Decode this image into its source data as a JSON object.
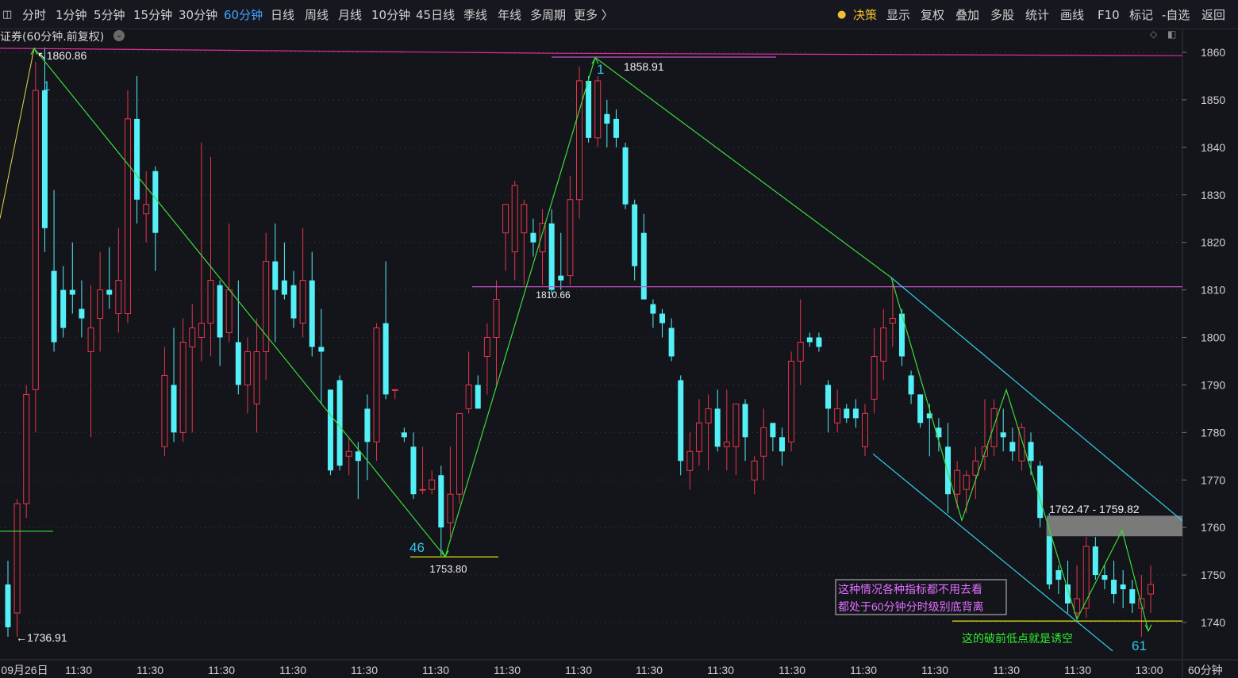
{
  "toolbar": {
    "periods": [
      "分时",
      "1分钟",
      "5分钟",
      "15分钟",
      "30分钟",
      "60分钟",
      "日线",
      "周线",
      "月线",
      "10分钟",
      "45日线",
      "季线",
      "年线",
      "多周期",
      "更多 〉"
    ],
    "active_period": "60分钟",
    "right": [
      "决策",
      "显示",
      "复权",
      "叠加",
      "多股",
      "统计",
      "画线",
      "F10",
      "标记",
      "-自选",
      "返回"
    ]
  },
  "chart_title": "证券(60分钟.前复权)",
  "period_label": "60分钟",
  "colors": {
    "up": "#e8364b",
    "down": "#54f0f7",
    "background": "#14141b",
    "grid": "#3a3a48",
    "zigzag": "#3bdc3b",
    "channel": "#30d5e6",
    "hline_magenta": "#c255c8",
    "hline_top": "#e0309a",
    "level_yellow": "#d4d414",
    "note_purple": "#e070ff",
    "note_green": "#2ef02e"
  },
  "chart_data": {
    "type": "candlestick",
    "ylim": [
      1731,
      1864
    ],
    "y_ticks": [
      1860,
      1850,
      1840,
      1830,
      1820,
      1810,
      1800,
      1790,
      1780,
      1770,
      1760,
      1750,
      1740
    ],
    "x_tick_labels": [
      "09月26日",
      "11:30",
      "11:30",
      "11:30",
      "11:30",
      "11:30",
      "11:30",
      "11:30",
      "11:30",
      "11:30",
      "11:30",
      "11:30",
      "11:30",
      "11:30",
      "11:30",
      "11:30",
      "13:00"
    ],
    "candles": [
      {
        "o": 1748,
        "h": 1753,
        "l": 1737,
        "c": 1739
      },
      {
        "o": 1742,
        "h": 1766,
        "l": 1737,
        "c": 1765
      },
      {
        "o": 1765,
        "h": 1790,
        "l": 1762,
        "c": 1788
      },
      {
        "o": 1789,
        "h": 1858,
        "l": 1780,
        "c": 1852
      },
      {
        "o": 1852,
        "h": 1861,
        "l": 1818,
        "c": 1823
      },
      {
        "o": 1814,
        "h": 1831,
        "l": 1797,
        "c": 1799
      },
      {
        "o": 1810,
        "h": 1815,
        "l": 1800,
        "c": 1802
      },
      {
        "o": 1810,
        "h": 1820,
        "l": 1805,
        "c": 1809
      },
      {
        "o": 1806,
        "h": 1812,
        "l": 1800,
        "c": 1804
      },
      {
        "o": 1797,
        "h": 1811,
        "l": 1779,
        "c": 1802
      },
      {
        "o": 1804,
        "h": 1818,
        "l": 1797,
        "c": 1810
      },
      {
        "o": 1810,
        "h": 1819,
        "l": 1806,
        "c": 1809
      },
      {
        "o": 1805,
        "h": 1823,
        "l": 1801,
        "c": 1812
      },
      {
        "o": 1805,
        "h": 1852,
        "l": 1803,
        "c": 1846
      },
      {
        "o": 1846,
        "h": 1855,
        "l": 1824,
        "c": 1829
      },
      {
        "o": 1826,
        "h": 1835,
        "l": 1820,
        "c": 1828
      },
      {
        "o": 1835,
        "h": 1836,
        "l": 1814,
        "c": 1822
      },
      {
        "o": 1777,
        "h": 1798,
        "l": 1775,
        "c": 1792
      },
      {
        "o": 1790,
        "h": 1802,
        "l": 1778,
        "c": 1780
      },
      {
        "o": 1780,
        "h": 1804,
        "l": 1778,
        "c": 1799
      },
      {
        "o": 1798,
        "h": 1807,
        "l": 1780,
        "c": 1802
      },
      {
        "o": 1800,
        "h": 1841,
        "l": 1795,
        "c": 1803
      },
      {
        "o": 1803,
        "h": 1838,
        "l": 1796,
        "c": 1812
      },
      {
        "o": 1811,
        "h": 1812,
        "l": 1794,
        "c": 1800
      },
      {
        "o": 1801,
        "h": 1824,
        "l": 1799,
        "c": 1810
      },
      {
        "o": 1799,
        "h": 1812,
        "l": 1788,
        "c": 1790
      },
      {
        "o": 1790,
        "h": 1800,
        "l": 1784,
        "c": 1797
      },
      {
        "o": 1786,
        "h": 1804,
        "l": 1780,
        "c": 1797
      },
      {
        "o": 1797,
        "h": 1822,
        "l": 1791,
        "c": 1816
      },
      {
        "o": 1816,
        "h": 1824,
        "l": 1799,
        "c": 1810
      },
      {
        "o": 1812,
        "h": 1820,
        "l": 1808,
        "c": 1809
      },
      {
        "o": 1811,
        "h": 1814,
        "l": 1802,
        "c": 1804
      },
      {
        "o": 1803,
        "h": 1823,
        "l": 1800,
        "c": 1812
      },
      {
        "o": 1812,
        "h": 1818,
        "l": 1796,
        "c": 1798
      },
      {
        "o": 1798,
        "h": 1806,
        "l": 1786,
        "c": 1797
      },
      {
        "o": 1789,
        "h": 1789,
        "l": 1771,
        "c": 1772
      },
      {
        "o": 1791,
        "h": 1792,
        "l": 1772,
        "c": 1773
      },
      {
        "o": 1775,
        "h": 1779,
        "l": 1771,
        "c": 1776
      },
      {
        "o": 1776,
        "h": 1778,
        "l": 1766,
        "c": 1774
      },
      {
        "o": 1785,
        "h": 1788,
        "l": 1770,
        "c": 1778
      },
      {
        "o": 1778,
        "h": 1803,
        "l": 1774,
        "c": 1802
      },
      {
        "o": 1803,
        "h": 1816,
        "l": 1787,
        "c": 1788
      },
      {
        "o": 1789,
        "h": 1789,
        "l": 1787,
        "c": 1789
      },
      {
        "o": 1780,
        "h": 1781,
        "l": 1778,
        "c": 1779
      },
      {
        "o": 1777,
        "h": 1780,
        "l": 1766,
        "c": 1767
      },
      {
        "o": 1768,
        "h": 1777,
        "l": 1767,
        "c": 1768
      },
      {
        "o": 1768,
        "h": 1772,
        "l": 1767,
        "c": 1770
      },
      {
        "o": 1771,
        "h": 1773,
        "l": 1754,
        "c": 1760
      },
      {
        "o": 1761,
        "h": 1777,
        "l": 1758,
        "c": 1767
      },
      {
        "o": 1767,
        "h": 1781,
        "l": 1765,
        "c": 1784
      },
      {
        "o": 1785,
        "h": 1797,
        "l": 1784,
        "c": 1790
      },
      {
        "o": 1790,
        "h": 1792,
        "l": 1786,
        "c": 1785
      },
      {
        "o": 1796,
        "h": 1803,
        "l": 1788,
        "c": 1800
      },
      {
        "o": 1800,
        "h": 1812,
        "l": 1790,
        "c": 1808
      },
      {
        "o": 1822,
        "h": 1824,
        "l": 1814,
        "c": 1828
      },
      {
        "o": 1818,
        "h": 1833,
        "l": 1812,
        "c": 1832
      },
      {
        "o": 1822,
        "h": 1829,
        "l": 1811,
        "c": 1828
      },
      {
        "o": 1822,
        "h": 1825,
        "l": 1817,
        "c": 1820
      },
      {
        "o": 1818,
        "h": 1827,
        "l": 1811,
        "c": 1824
      },
      {
        "o": 1824,
        "h": 1827,
        "l": 1809,
        "c": 1810
      },
      {
        "o": 1813,
        "h": 1822,
        "l": 1810,
        "c": 1812
      },
      {
        "o": 1813,
        "h": 1834,
        "l": 1811,
        "c": 1829
      },
      {
        "o": 1829,
        "h": 1857,
        "l": 1825,
        "c": 1854
      },
      {
        "o": 1854,
        "h": 1855,
        "l": 1841,
        "c": 1842
      },
      {
        "o": 1842,
        "h": 1855,
        "l": 1840,
        "c": 1854
      },
      {
        "o": 1847,
        "h": 1850,
        "l": 1840,
        "c": 1845
      },
      {
        "o": 1846,
        "h": 1848,
        "l": 1840,
        "c": 1842
      },
      {
        "o": 1840,
        "h": 1841,
        "l": 1827,
        "c": 1828
      },
      {
        "o": 1828,
        "h": 1829,
        "l": 1812,
        "c": 1815
      },
      {
        "o": 1822,
        "h": 1826,
        "l": 1808,
        "c": 1808
      },
      {
        "o": 1807,
        "h": 1808,
        "l": 1802,
        "c": 1805
      },
      {
        "o": 1805,
        "h": 1806,
        "l": 1800,
        "c": 1803
      },
      {
        "o": 1802,
        "h": 1804,
        "l": 1795,
        "c": 1796
      },
      {
        "o": 1791,
        "h": 1792,
        "l": 1771,
        "c": 1774
      },
      {
        "o": 1772,
        "h": 1780,
        "l": 1768,
        "c": 1776
      },
      {
        "o": 1776,
        "h": 1787,
        "l": 1773,
        "c": 1782
      },
      {
        "o": 1782,
        "h": 1788,
        "l": 1772,
        "c": 1785
      },
      {
        "o": 1785,
        "h": 1789,
        "l": 1776,
        "c": 1777
      },
      {
        "o": 1777,
        "h": 1789,
        "l": 1772,
        "c": 1778
      },
      {
        "o": 1777,
        "h": 1786,
        "l": 1771,
        "c": 1786
      },
      {
        "o": 1786,
        "h": 1787,
        "l": 1774,
        "c": 1779
      },
      {
        "o": 1770,
        "h": 1775,
        "l": 1767,
        "c": 1774
      },
      {
        "o": 1775,
        "h": 1785,
        "l": 1770,
        "c": 1781
      },
      {
        "o": 1782,
        "h": 1782,
        "l": 1776,
        "c": 1779
      },
      {
        "o": 1779,
        "h": 1781,
        "l": 1773,
        "c": 1776
      },
      {
        "o": 1778,
        "h": 1797,
        "l": 1776,
        "c": 1795
      },
      {
        "o": 1795,
        "h": 1808,
        "l": 1790,
        "c": 1799
      },
      {
        "o": 1800,
        "h": 1801,
        "l": 1798,
        "c": 1799
      },
      {
        "o": 1800,
        "h": 1801,
        "l": 1797,
        "c": 1798
      },
      {
        "o": 1790,
        "h": 1791,
        "l": 1780,
        "c": 1785
      },
      {
        "o": 1782,
        "h": 1789,
        "l": 1780,
        "c": 1785
      },
      {
        "o": 1785,
        "h": 1786,
        "l": 1782,
        "c": 1783
      },
      {
        "o": 1785,
        "h": 1787,
        "l": 1781,
        "c": 1783
      },
      {
        "o": 1777,
        "h": 1786,
        "l": 1775,
        "c": 1784
      },
      {
        "o": 1787,
        "h": 1802,
        "l": 1784,
        "c": 1796
      },
      {
        "o": 1795,
        "h": 1806,
        "l": 1791,
        "c": 1802
      },
      {
        "o": 1803,
        "h": 1812,
        "l": 1798,
        "c": 1804
      },
      {
        "o": 1805,
        "h": 1806,
        "l": 1794,
        "c": 1796
      },
      {
        "o": 1792,
        "h": 1793,
        "l": 1786,
        "c": 1788
      },
      {
        "o": 1788,
        "h": 1788,
        "l": 1781,
        "c": 1782
      },
      {
        "o": 1784,
        "h": 1786,
        "l": 1775,
        "c": 1783
      },
      {
        "o": 1781,
        "h": 1783,
        "l": 1776,
        "c": 1779
      },
      {
        "o": 1777,
        "h": 1782,
        "l": 1763,
        "c": 1767
      },
      {
        "o": 1767,
        "h": 1774,
        "l": 1764,
        "c": 1772
      },
      {
        "o": 1768,
        "h": 1772,
        "l": 1763,
        "c": 1771
      },
      {
        "o": 1771,
        "h": 1777,
        "l": 1766,
        "c": 1774
      },
      {
        "o": 1775,
        "h": 1787,
        "l": 1772,
        "c": 1777
      },
      {
        "o": 1777,
        "h": 1787,
        "l": 1775,
        "c": 1785
      },
      {
        "o": 1780,
        "h": 1785,
        "l": 1776,
        "c": 1779
      },
      {
        "o": 1778,
        "h": 1781,
        "l": 1774,
        "c": 1776
      },
      {
        "o": 1774,
        "h": 1782,
        "l": 1772,
        "c": 1781
      },
      {
        "o": 1778,
        "h": 1780,
        "l": 1771,
        "c": 1774
      },
      {
        "o": 1773,
        "h": 1774,
        "l": 1760,
        "c": 1762
      },
      {
        "o": 1761,
        "h": 1763,
        "l": 1747,
        "c": 1748
      },
      {
        "o": 1751,
        "h": 1752,
        "l": 1746,
        "c": 1749
      },
      {
        "o": 1748,
        "h": 1753,
        "l": 1742,
        "c": 1744
      },
      {
        "o": 1742,
        "h": 1752,
        "l": 1740,
        "c": 1745
      },
      {
        "o": 1743,
        "h": 1758,
        "l": 1741,
        "c": 1756
      },
      {
        "o": 1756,
        "h": 1758,
        "l": 1749,
        "c": 1750
      },
      {
        "o": 1750,
        "h": 1752,
        "l": 1747,
        "c": 1749
      },
      {
        "o": 1749,
        "h": 1753,
        "l": 1744,
        "c": 1746
      },
      {
        "o": 1748,
        "h": 1751,
        "l": 1743,
        "c": 1747
      },
      {
        "o": 1747,
        "h": 1749,
        "l": 1742,
        "c": 1744
      },
      {
        "o": 1743,
        "h": 1750,
        "l": 1737,
        "c": 1745
      },
      {
        "o": 1746,
        "h": 1752,
        "l": 1742,
        "c": 1748
      }
    ]
  },
  "annotations": {
    "hi_label": "1860.86",
    "lo_label": "←1736.91",
    "peak2_label": "1858.91",
    "trough1_label": "1753.80",
    "mid_label": "1810.66",
    "range_label": "1762.47 - 1759.82",
    "count_1a": "1",
    "count_1b": "1",
    "count_46": "46",
    "count_61": "61",
    "note_line1": "这种情况各种指标都不用去看",
    "note_line2": "都处于60分钟分时级别底背离",
    "note_green": "这的破前低点就是诱空"
  }
}
